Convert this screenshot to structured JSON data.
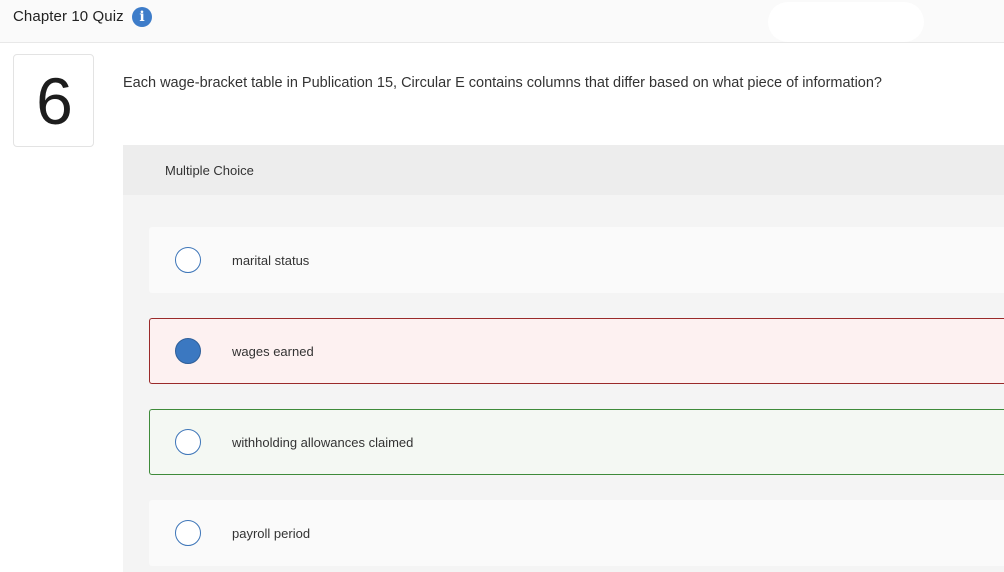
{
  "header": {
    "title": "Chapter 10 Quiz",
    "info_icon": "i"
  },
  "question": {
    "number": "6",
    "text": "Each wage-bracket table in Publication 15, Circular E contains columns that differ based on what piece of information?"
  },
  "multiple_choice": {
    "label": "Multiple Choice",
    "options": [
      {
        "text": "marital status",
        "selected": false,
        "state": "neutral"
      },
      {
        "text": "wages earned",
        "selected": true,
        "state": "incorrect"
      },
      {
        "text": "withholding allowances claimed",
        "selected": false,
        "state": "correct"
      },
      {
        "text": "payroll period",
        "selected": false,
        "state": "neutral"
      }
    ]
  },
  "colors": {
    "accent_blue": "#3d7cc9",
    "incorrect_border": "#9a2a2a",
    "incorrect_bg": "#fdf1f1",
    "correct_border": "#3e8a3a",
    "correct_bg": "#f4f8f3"
  }
}
